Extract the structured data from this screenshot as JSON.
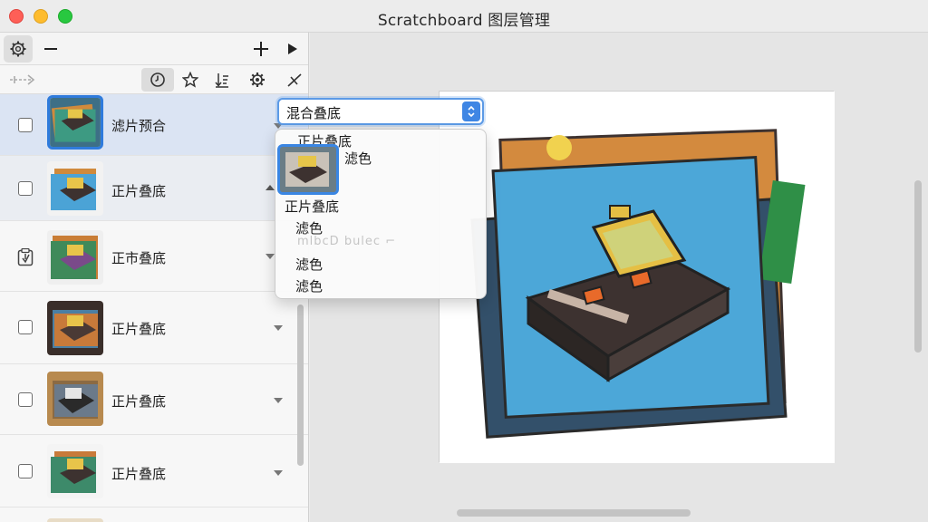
{
  "window": {
    "title": "Scratchboard 图层管理"
  },
  "toolbar": {
    "settings_icon": "gear-icon",
    "remove_icon": "minus-icon",
    "add_icon": "plus-icon",
    "play_icon": "play-triangle-icon"
  },
  "toolbar2": {
    "icons": [
      "arrow-link-icon",
      "history-clock-icon",
      "star-icon",
      "sort-icon",
      "cog-icon",
      "tool-icon"
    ]
  },
  "layers": [
    {
      "label": "滤片预合",
      "checked": false,
      "selected": true,
      "arrow": "down"
    },
    {
      "label": "正片叠底",
      "checked": false,
      "selected": false,
      "arrow": "up"
    },
    {
      "label": "正市叠底",
      "checked": true,
      "selected": false,
      "arrow": "down"
    },
    {
      "label": "正片叠底",
      "checked": false,
      "selected": false,
      "arrow": "down"
    },
    {
      "label": "正片叠底",
      "checked": false,
      "selected": false,
      "arrow": "down"
    },
    {
      "label": "正片叠底",
      "checked": false,
      "selected": false,
      "arrow": "down"
    }
  ],
  "blend_select": {
    "value": "混合叠底"
  },
  "blend_menu": {
    "items": [
      "正片叠底",
      "滤色",
      "正片叠底",
      "滤色",
      "滤色",
      "滤色"
    ],
    "ghost": "mlbcD bulec ⌐"
  },
  "colors": {
    "accent": "#2f7bdc",
    "selected_row": "#dbe4f3",
    "orange": "#d98a3c",
    "blue": "#4ba3d6",
    "green": "#3d8a5a",
    "yellow": "#e8c44a",
    "dark": "#3d3230"
  }
}
